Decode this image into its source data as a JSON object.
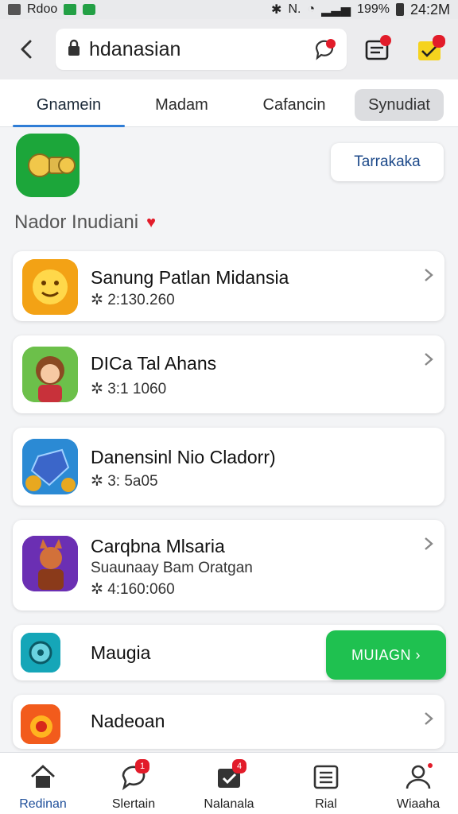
{
  "status_bar": {
    "left_text": "Rdoo",
    "right_mid": "N.",
    "battery": "199%",
    "time": "24:2M"
  },
  "search": {
    "value": "hdanasian"
  },
  "tabs": [
    {
      "label": "Gnamein"
    },
    {
      "label": "Madam"
    },
    {
      "label": "Cafancin"
    },
    {
      "label": "Synudiat"
    }
  ],
  "action_button": {
    "label": "Tarrakaka"
  },
  "section": {
    "title": "Nador Inudiani"
  },
  "cards": [
    {
      "title": "Sanung Patlan Midansia",
      "meta": "2:130.260"
    },
    {
      "title": "DICa Tal Ahans",
      "meta": "3:1 1060"
    },
    {
      "title": "Danensinl Nio Cladorr)",
      "meta": "3: 5a05"
    },
    {
      "title": "Carqbna Mlsaria",
      "sub": "Suaunaay Bam Oratgan",
      "meta": "4:160:060"
    },
    {
      "title": "Maugia"
    },
    {
      "title": "Nadeoan"
    }
  ],
  "install_button": {
    "label": "MUIAGN"
  },
  "bottom_nav": [
    {
      "label": "Redinan",
      "icon": "home-icon"
    },
    {
      "label": "Slertain",
      "icon": "chat-icon",
      "badge": "1"
    },
    {
      "label": "Nalanala",
      "icon": "calendar-check-icon",
      "badge": "4"
    },
    {
      "label": "Rial",
      "icon": "list-icon"
    },
    {
      "label": "Wiaaha",
      "icon": "profile-icon"
    }
  ],
  "colors": {
    "accent_blue": "#2f7dd6",
    "install_green": "#1fc150",
    "badge_red": "#e21c2a",
    "app_green": "#1ca63a"
  }
}
